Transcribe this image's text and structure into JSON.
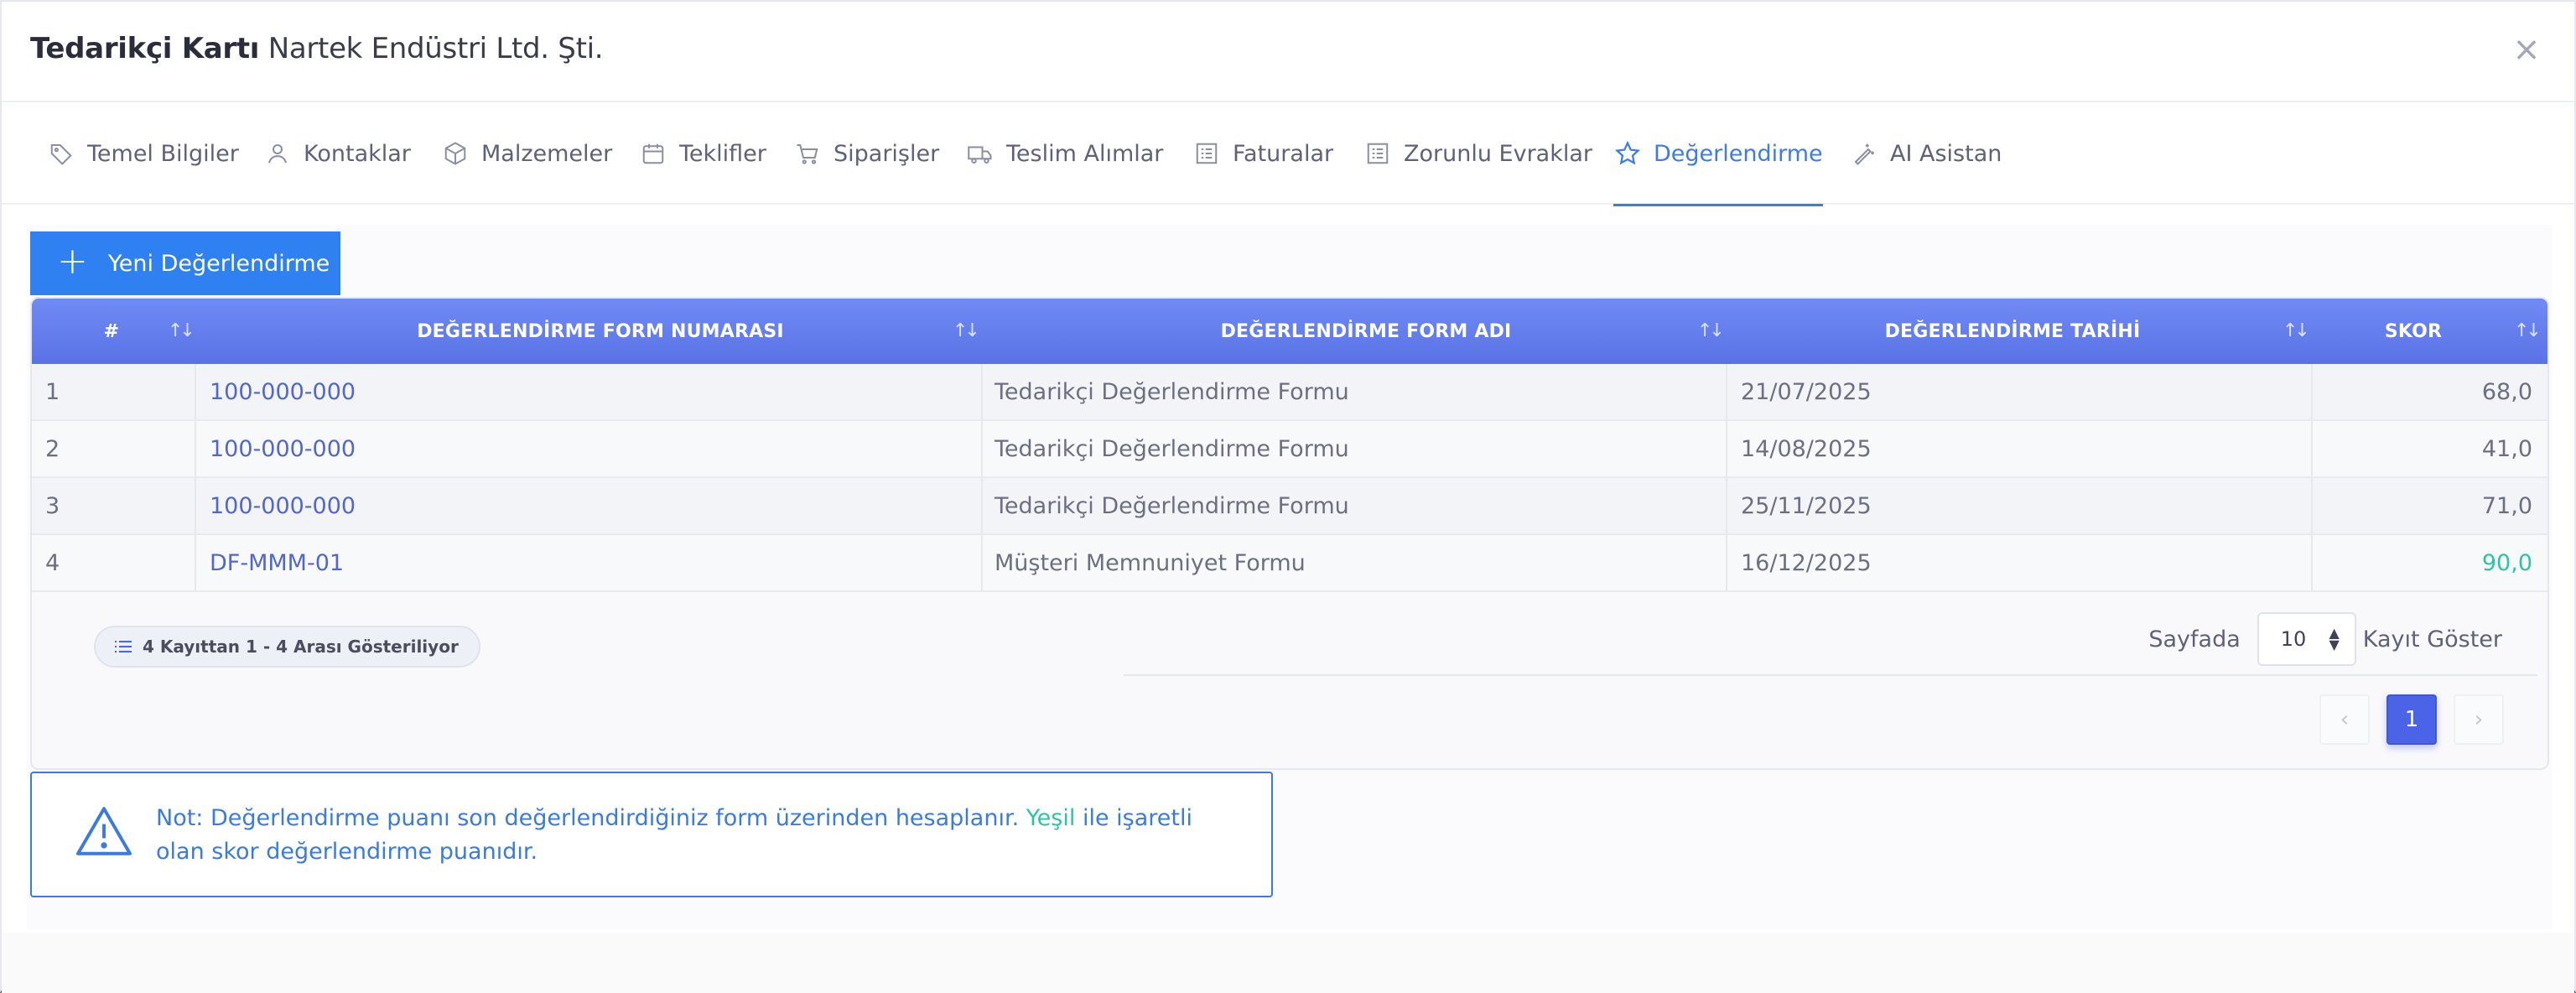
{
  "header": {
    "title_strong": "Tedarikçi Kartı",
    "title_name": "Nartek Endüstri Ltd. Şti.",
    "close_label": "×"
  },
  "tabs": [
    {
      "label": "Temel Bilgiler",
      "icon": "tag-icon"
    },
    {
      "label": "Kontaklar",
      "icon": "user-icon"
    },
    {
      "label": "Malzemeler",
      "icon": "box-icon"
    },
    {
      "label": "Teklifler",
      "icon": "calendar-icon"
    },
    {
      "label": "Siparişler",
      "icon": "cart-icon"
    },
    {
      "label": "Teslim Alımlar",
      "icon": "truck-icon"
    },
    {
      "label": "Faturalar",
      "icon": "list-icon"
    },
    {
      "label": "Zorunlu Evraklar",
      "icon": "list-icon"
    },
    {
      "label": "Değerlendirme",
      "icon": "star-icon",
      "active": true
    },
    {
      "label": "AI Asistan",
      "icon": "wand-icon"
    }
  ],
  "toolbar": {
    "new_label": "Yeni Değerlendirme"
  },
  "table": {
    "columns": [
      "#",
      "DEĞERLENDİRME FORM NUMARASI",
      "DEĞERLENDİRME FORM ADI",
      "DEĞERLENDİRME TARİHİ",
      "SKOR"
    ],
    "rows": [
      {
        "no": "1",
        "form_no": "100-000-000",
        "form_name": "Tedarikçi Değerlendirme Formu",
        "date": "21/07/2025",
        "score": "68,0",
        "highlight": false
      },
      {
        "no": "2",
        "form_no": "100-000-000",
        "form_name": "Tedarikçi Değerlendirme Formu",
        "date": "14/08/2025",
        "score": "41,0",
        "highlight": false
      },
      {
        "no": "3",
        "form_no": "100-000-000",
        "form_name": "Tedarikçi Değerlendirme Formu",
        "date": "25/11/2025",
        "score": "71,0",
        "highlight": false
      },
      {
        "no": "4",
        "form_no": "DF-MMM-01",
        "form_name": "Müşteri Memnuniyet Formu",
        "date": "16/12/2025",
        "score": "90,0",
        "highlight": true
      }
    ]
  },
  "footer": {
    "info": "4 Kayıttan 1 - 4 Arası Gösteriliyor",
    "per_page_prefix": "Sayfada",
    "per_page_value": "10",
    "per_page_suffix": "Kayıt Göster",
    "current_page": "1",
    "prev": "‹",
    "next": "›"
  },
  "note": {
    "part1": "Not: Değerlendirme puanı son değerlendirdiğiniz form üzerinden hesaplanır.",
    "green": "Yeşil",
    "part2": "ile işaretli olan skor değerlendirme puanıdır."
  },
  "colors": {
    "accent": "#3e7be6",
    "header_bg": "#6f8bf4",
    "green": "#2cc4a3",
    "button": "#2f80f0"
  }
}
